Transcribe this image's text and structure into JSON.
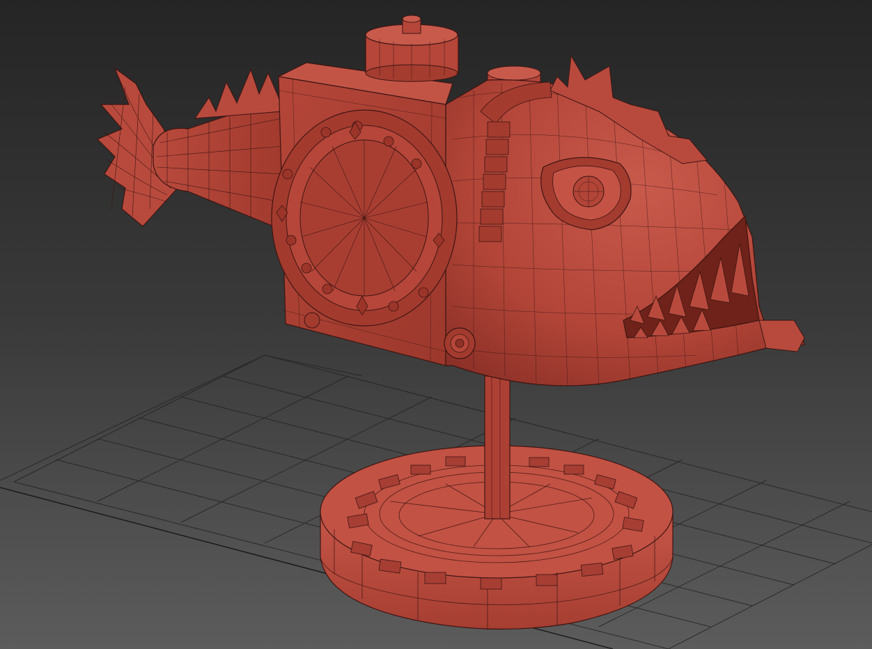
{
  "viewport": {
    "background_top": "#252525",
    "background_bottom": "#5b5b5b",
    "grid_color": "#1f1f1f"
  },
  "model": {
    "name": "steampunk-anglerfish-submarine",
    "base_color": "#b94c40",
    "shade_color": "#8c3128",
    "highlight_color": "#d4665a",
    "wire_color": "#3d1512"
  }
}
